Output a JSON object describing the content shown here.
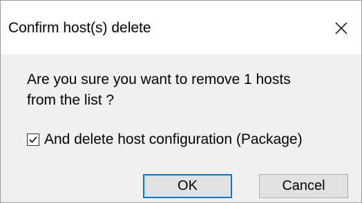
{
  "dialog": {
    "title": "Confirm host(s) delete",
    "message_line1": "Are you sure you want to remove 1 hosts",
    "message_line2": "from the list ?",
    "checkbox": {
      "label": "And delete host configuration (Package)",
      "checked": true
    },
    "buttons": {
      "ok_label": "OK",
      "cancel_label": "Cancel"
    },
    "icons": {
      "close": "close-icon",
      "check": "checkmark-icon"
    },
    "colors": {
      "title_bg": "#ffffff",
      "body_bg": "#f0f0f0",
      "default_button_border": "#0078d7"
    }
  }
}
